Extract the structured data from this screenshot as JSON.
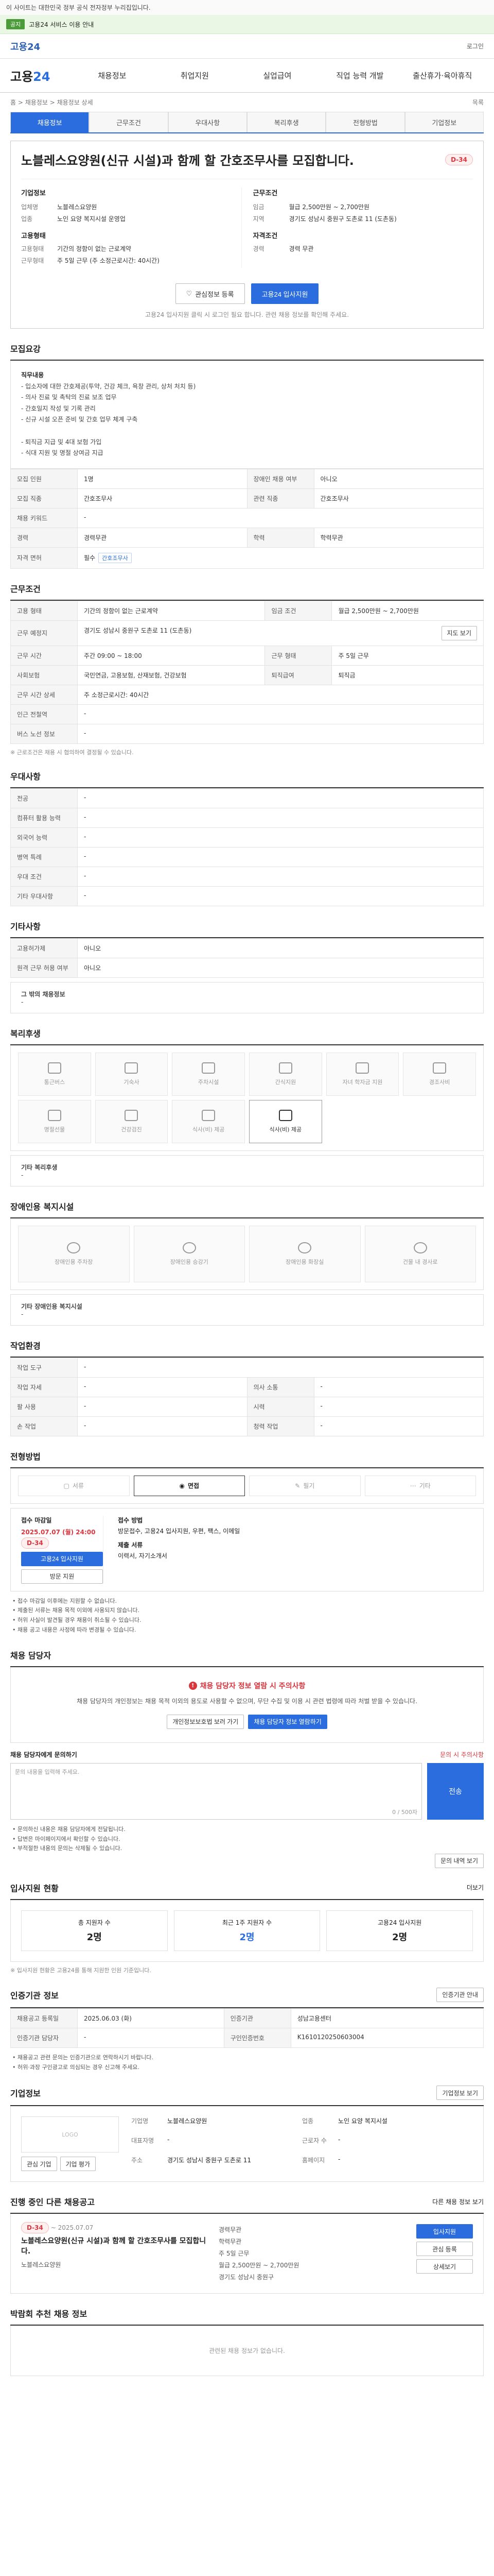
{
  "top": {
    "note": "이 사이트는 대한민국 정부 공식 전자정부 누리집입니다.",
    "alert_pill": "공지",
    "alert_text": "고용24 서비스 이용 안내"
  },
  "header": {
    "logo": "고용24",
    "login": "로그인",
    "brand_prefix": "고용",
    "brand_suffix": "24",
    "menu": [
      "채용정보",
      "취업지원",
      "실업급여",
      "직업 능력 개발",
      "출산휴가·육아휴직"
    ]
  },
  "breadcrumb": {
    "path": "홈 > 채용정보 > 채용정보 상세",
    "right": "목록"
  },
  "tabs": [
    "채용정보",
    "근무조건",
    "우대사항",
    "복리후생",
    "전형방법",
    "기업정보"
  ],
  "job": {
    "title": "노블레스요양원(신규 시설)과 함께 할 간호조무사를 모집합니다.",
    "dday": "D-34",
    "company_header": "기업정보",
    "company_rows": [
      {
        "k": "업체명",
        "v": "노블레스요양원"
      },
      {
        "k": "업종",
        "v": "노인 요양 복지시설 운영업"
      }
    ],
    "cond_header": "근무조건",
    "cond_rows": [
      {
        "k": "임금",
        "v": "월급 2,500만원 ~ 2,700만원"
      },
      {
        "k": "지역",
        "v": "경기도 성남시 중원구 도촌로 11 (도촌동)"
      }
    ],
    "employ_header": "고용형태",
    "employ_rows": [
      {
        "k": "고용형태",
        "v": "기간의 정함이 없는 근로계약"
      },
      {
        "k": "근무형태",
        "v": "주 5일 근무 (주 소정근로시간: 40시간)"
      }
    ],
    "qual_header": "자격조건",
    "qual_rows": [
      {
        "k": "경력",
        "v": "경력 무관"
      }
    ],
    "scrap_label": "관심정보 등록",
    "apply_label": "고용24 입사지원",
    "head_note": "고용24 입사지원 클릭 시 로그인 필요 합니다. 관련 채용 정보를 확인해 주세요."
  },
  "recruit": {
    "section_title": "모집요강",
    "job_title_label": "직무내용",
    "job_text": [
      "- 입소자에 대한 간호제공(투약, 건강 체크, 욕창 관리, 상처 처치 등)",
      "- 의사 진료 및 촉탁의 진료 보조 업무",
      "- 간호일지 작성 및 기록 관리",
      "- 신규 시설 오픈 준비 및 간호 업무 체계 구축"
    ],
    "benefit_lines": [
      "- 퇴직금 지급 및 4대 보험 가입",
      "- 식대 지원 및 명절 상여금 지급"
    ],
    "rows": [
      {
        "k": "모집 인원",
        "v": "1명",
        "k2": "장애인 채용 여부",
        "v2": "아니오"
      },
      {
        "k": "모집 직종",
        "v": "간호조무사",
        "k2": "관련 직종",
        "v2": "간호조무사"
      },
      {
        "k": "채용 키워드",
        "v": "-",
        "k2": "",
        "v2": ""
      },
      {
        "k": "경력",
        "v": "경력무관",
        "k2": "학력",
        "v2": "학력무관"
      },
      {
        "k": "자격 면허",
        "v": "필수",
        "k2": "",
        "v2": ""
      }
    ],
    "license_tag": "간호조무사"
  },
  "work": {
    "section_title": "근무조건",
    "rows": [
      {
        "k": "고용 형태",
        "v": "기간의 정함이 없는 근로계약",
        "k2": "임금 조건",
        "v2": "월급 2,500만원 ~ 2,700만원"
      },
      {
        "k": "근무 예정지",
        "v": "경기도 성남시 중원구 도촌로 11 (도촌동)",
        "k2": "",
        "v2": ""
      },
      {
        "k": "근무 시간",
        "v": "주간 09:00 ~ 18:00",
        "k2": "근무 형태",
        "v2": "주 5일 근무"
      },
      {
        "k": "사회보험",
        "v": "국민연금, 고용보험, 산재보험, 건강보험",
        "k2": "퇴직급여",
        "v2": "퇴직금"
      },
      {
        "k": "근무 시간 상세",
        "v": "주 소정근로시간: 40시간",
        "k2": "",
        "v2": ""
      },
      {
        "k": "인근 전철역",
        "v": "-",
        "k2": "",
        "v2": ""
      },
      {
        "k": "버스 노선 정보",
        "v": "-",
        "k2": "",
        "v2": ""
      }
    ],
    "map_label": "지도 보기",
    "note": "※ 근로조건은 채용 시 협의하여 결정될 수 있습니다."
  },
  "pref": {
    "section_title": "우대사항",
    "rows": [
      {
        "k": "전공",
        "v": "-"
      },
      {
        "k": "컴퓨터 활용 능력",
        "v": "-"
      },
      {
        "k": "외국어 능력",
        "v": "-"
      },
      {
        "k": "병역 특례",
        "v": "-"
      },
      {
        "k": "우대 조건",
        "v": "-"
      },
      {
        "k": "기타 우대사항",
        "v": "-"
      }
    ]
  },
  "etc": {
    "section_title": "기타사항",
    "rows": [
      {
        "k": "고용허가제",
        "v": "아니오"
      },
      {
        "k": "원격 근무 허용 여부",
        "v": "아니오"
      }
    ],
    "extra_label": "그 밖의 채용정보",
    "extra_value": "-"
  },
  "welfare": {
    "section_title": "복리후생",
    "items": [
      {
        "label": "통근버스",
        "on": false
      },
      {
        "label": "기숙사",
        "on": false
      },
      {
        "label": "주차시설",
        "on": false
      },
      {
        "label": "간식지원",
        "on": false
      },
      {
        "label": "자녀 학자금 지원",
        "on": false
      },
      {
        "label": "경조사비",
        "on": false
      },
      {
        "label": "명절선물",
        "on": false
      },
      {
        "label": "건강검진",
        "on": false
      },
      {
        "label": "식사(비) 제공",
        "on": false
      },
      {
        "label": "식사(비) 제공",
        "on": true
      }
    ],
    "extra_label": "기타 복리후생",
    "extra_value": "-"
  },
  "disabled": {
    "section_title": "장애인용 복지시설",
    "items": [
      "장애인용 주차장",
      "장애인용 승강기",
      "장애인용 화장실",
      "건물 내 경사로"
    ],
    "extra_label": "기타 장애인용 복지시설",
    "extra_value": "-"
  },
  "env": {
    "section_title": "작업환경",
    "rows": [
      {
        "k": "작업 도구",
        "v": "-",
        "k2": "",
        "v2": ""
      },
      {
        "k": "작업 자세",
        "v": "-",
        "k2": "의사 소통",
        "v2": "-"
      },
      {
        "k": "팔 사용",
        "v": "-",
        "k2": "시력",
        "v2": "-"
      },
      {
        "k": "손 작업",
        "v": "-",
        "k2": "청력 작업",
        "v2": "-"
      }
    ]
  },
  "process": {
    "section_title": "전형방법",
    "methods": [
      {
        "label": "서류",
        "on": false
      },
      {
        "label": "면접",
        "on": true
      },
      {
        "label": "필기",
        "on": false
      },
      {
        "label": "기타",
        "on": false
      }
    ],
    "apply_label": "접수 마감일",
    "apply_date": "2025.07.07 (월) 24:00",
    "apply_badge": "D-34",
    "apply_btn": "고용24 입사지원",
    "apply_btn2": "방문 지원",
    "method_label": "접수 방법",
    "method_value": "방문접수, 고용24 입사지원, 우편, 팩스, 이메일",
    "doc_label": "제출 서류",
    "doc_value": "이력서, 자기소개서",
    "notes": [
      "접수 마감일 이후에는 지원할 수 없습니다.",
      "제출된 서류는 채용 목적 이외에 사용되지 않습니다.",
      "허위 사실이 발견될 경우 채용이 취소될 수 있습니다.",
      "채용 공고 내용은 사정에 따라 변경될 수 있습니다."
    ]
  },
  "contact": {
    "section_title": "채용 담당자",
    "warn": "채용 담당자 정보 열람 시 주의사항",
    "text": "채용 담당자의 개인정보는 채용 목적 이외의 용도로 사용할 수 없으며, 무단 수집 및 이용 시 관련 법령에 따라 처벌 받을 수 있습니다.",
    "btn1": "개인정보보호법 보러 가기",
    "btn2": "채용 담당자 정보 열람하기",
    "inquiry_label": "채용 담당자에게 문의하기",
    "inquiry_link": "문의 시 주의사항",
    "inquiry_placeholder": "문의 내용을 입력해 주세요.",
    "inquiry_count": "0 / 500자",
    "inquiry_btn": "전송",
    "notes": [
      "문의하신 내용은 채용 담당자에게 전달됩니다.",
      "답변은 마이페이지에서 확인할 수 있습니다.",
      "부적절한 내용의 문의는 삭제될 수 있습니다."
    ],
    "notes_btn": "문의 내역 보기"
  },
  "status": {
    "section_title": "입사지원 현황",
    "more": "더보기",
    "stats": [
      {
        "label": "총 지원자 수",
        "n": "2명",
        "blue": false
      },
      {
        "label": "최근 1주 지원자 수",
        "n": "2명",
        "blue": true
      },
      {
        "label": "고용24 입사지원",
        "n": "2명",
        "blue": false
      }
    ],
    "note": "※ 입사지원 현황은 고용24를 통해 지원한 인원 기준입니다."
  },
  "agency": {
    "section_title": "인증기관 정보",
    "btn": "인증기관 안내",
    "rows": [
      {
        "k": "채용공고 등록일",
        "v": "2025.06.03 (화)",
        "k2": "인증기관",
        "v2": "성남고용센터"
      },
      {
        "k": "인증기관 담당자",
        "v": "-",
        "k2": "구인인증번호",
        "v2": "K1610120250603004"
      }
    ],
    "notes": [
      "채용공고 관련 문의는 인증기관으로 연락하시기 바랍니다.",
      "허위·과장 구인광고로 의심되는 경우 신고해 주세요."
    ]
  },
  "company": {
    "section_title": "기업정보",
    "btn": "기업정보 보기",
    "logo_text": "LOGO",
    "logo_btn1": "관심 기업",
    "logo_btn2": "기업 평가",
    "info": [
      {
        "k": "기업명",
        "v": "노블레스요양원"
      },
      {
        "k": "업종",
        "v": "노인 요양 복지시설"
      },
      {
        "k": "대표자명",
        "v": "-"
      },
      {
        "k": "근로자 수",
        "v": "-"
      },
      {
        "k": "주소",
        "v": "경기도 성남시 중원구 도촌로 11"
      },
      {
        "k": "홈페이지",
        "v": "-"
      }
    ]
  },
  "similar": {
    "section_title": "진행 중인 다른 채용공고",
    "more": "다른 채용 정보 보기",
    "dday": "D-34",
    "date": "~ 2025.07.07",
    "title": "노블레스요양원(신규 시설)과 함께 할 간호조무사를 모집합니다.",
    "company": "노블레스요양원",
    "meta": [
      "경력무관",
      "학력무관",
      "주 5일 근무",
      "월급 2,500만원 ~ 2,700만원",
      "경기도 성남시 중원구"
    ],
    "btn1": "입사지원",
    "btn2": "관심 등록",
    "btn3": "상세보기"
  },
  "recent": {
    "section_title": "박람회 추천 채용 정보",
    "empty": "관련된 채용 정보가 없습니다."
  }
}
